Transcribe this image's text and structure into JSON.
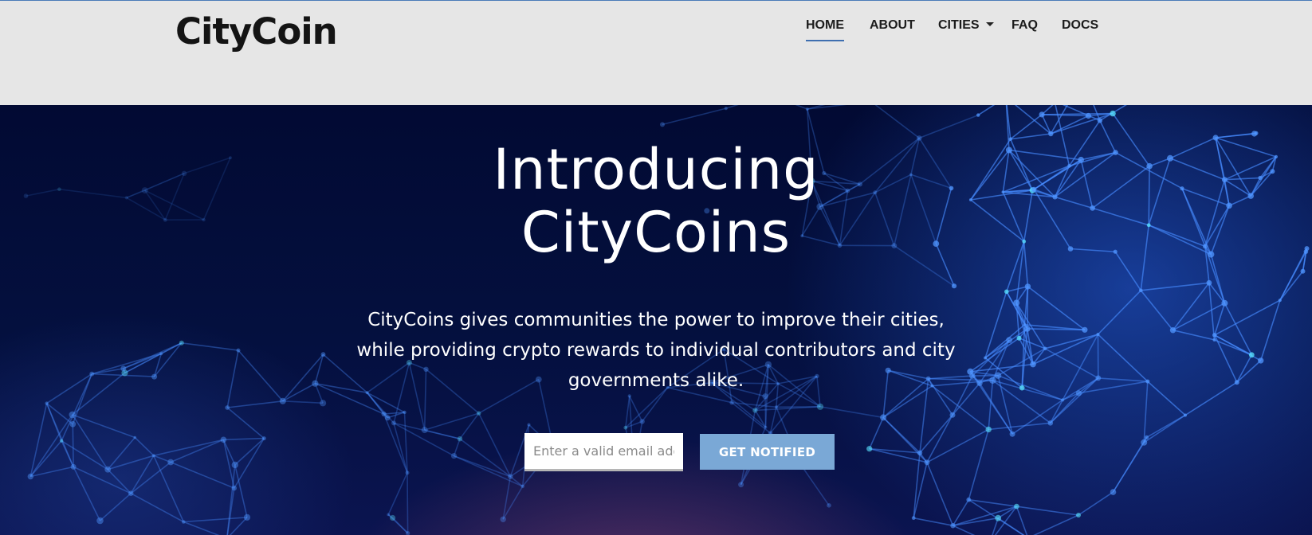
{
  "header": {
    "logo": "CityCoin",
    "nav": [
      {
        "label": "HOME",
        "active": true
      },
      {
        "label": "ABOUT",
        "active": false
      },
      {
        "label": "CITIES",
        "active": false,
        "has_dropdown": true
      },
      {
        "label": "FAQ",
        "active": false
      },
      {
        "label": "DOCS",
        "active": false
      }
    ]
  },
  "hero": {
    "title_line1": "Introducing",
    "title_line2": "CityCoins",
    "subtitle": "CityCoins gives communities the power to improve their cities, while providing crypto rewards to individual contributors and city governments alike.",
    "email_placeholder": "Enter a valid email address",
    "button_label": "GET NOTIFIED"
  },
  "colors": {
    "header_bg": "#e6e6e6",
    "accent": "#3f6fb0",
    "button_bg": "#7aa8d6",
    "hero_bg": "#020a33"
  },
  "icons": {
    "cities_dropdown": "caret-down-icon",
    "background": "network-mesh-graphic"
  }
}
